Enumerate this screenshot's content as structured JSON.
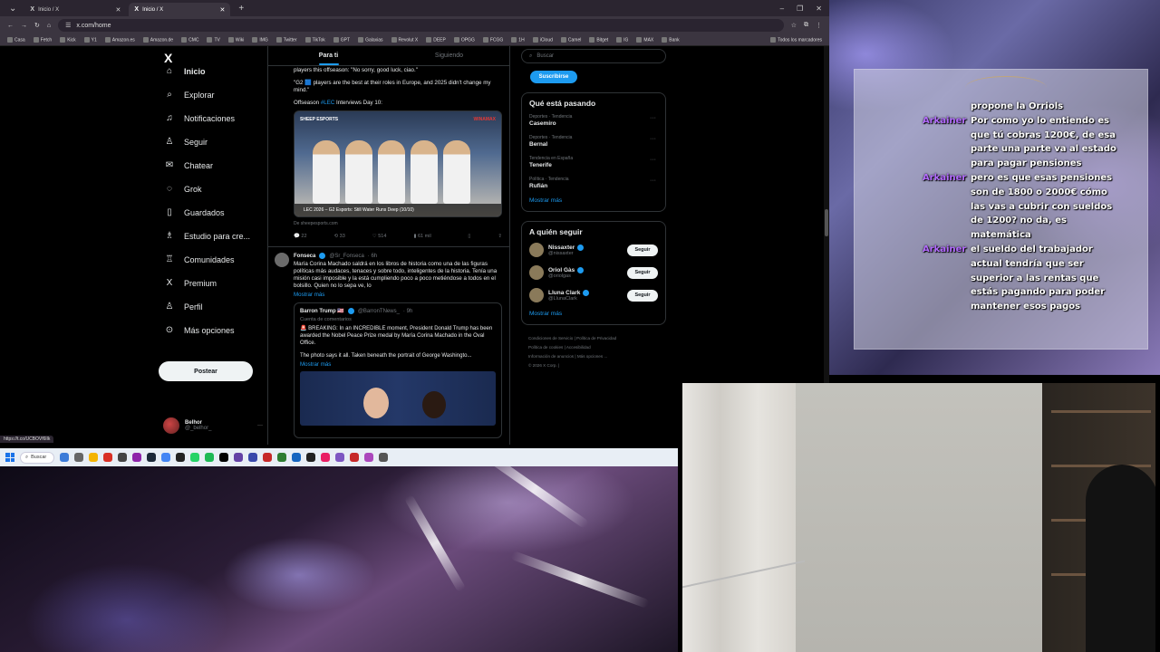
{
  "browser": {
    "tabs": [
      {
        "title": "Inicio / X",
        "active": false
      },
      {
        "title": "Inicio / X",
        "active": true
      }
    ],
    "url": "x.com/home",
    "bookmarks": [
      "Casa",
      "Fetch",
      "Kick",
      "Y1",
      "Amazon.es",
      "Amazon.de",
      "CMC",
      "TV",
      "Wiki",
      "IMG",
      "Twitter",
      "TikTok",
      "GPT",
      "Galaxias",
      "Revolut X",
      "DEEP",
      "OPGG",
      "FCGG",
      "1H",
      "iCloud",
      "Camel",
      "Bitget",
      "IG",
      "MAX",
      "Bank"
    ],
    "all_bookmarks": "Todos los marcadores",
    "status_url": "https://t.co/UCBOVf6lIk"
  },
  "nav": {
    "items": [
      {
        "label": "Inicio",
        "icon": "home-icon",
        "glyph": "⌂"
      },
      {
        "label": "Explorar",
        "icon": "search-icon",
        "glyph": "⌕"
      },
      {
        "label": "Notificaciones",
        "icon": "bell-icon",
        "glyph": "♫"
      },
      {
        "label": "Seguir",
        "icon": "follow-icon",
        "glyph": "♙"
      },
      {
        "label": "Chatear",
        "icon": "chat-icon",
        "glyph": "✉"
      },
      {
        "label": "Grok",
        "icon": "grok-icon",
        "glyph": "◌"
      },
      {
        "label": "Guardados",
        "icon": "bookmark-icon",
        "glyph": "▯"
      },
      {
        "label": "Estudio para cre...",
        "icon": "studio-icon",
        "glyph": "♗"
      },
      {
        "label": "Comunidades",
        "icon": "communities-icon",
        "glyph": "♖"
      },
      {
        "label": "Premium",
        "icon": "premium-x-icon",
        "glyph": "X"
      },
      {
        "label": "Perfil",
        "icon": "profile-icon",
        "glyph": "♙"
      },
      {
        "label": "Más opciones",
        "icon": "more-icon",
        "glyph": "⊙"
      }
    ],
    "post_label": "Postear",
    "profile_name": "Belhor",
    "profile_handle": "@_belhor_"
  },
  "feed": {
    "tabs": [
      "Para ti",
      "Siguiendo"
    ],
    "tweet1": {
      "text_top": "players this offseason: \"No sorry, good luck, ciao.\"",
      "text_mid": "\"G2 🟦 players are the best at their roles in Europe, and 2025 didn't change my mind.\"",
      "text_pre": "Offseason",
      "hashtag": "#LEC",
      "text_post": "Interviews Day 10:",
      "media_logo": "SHEEP ESPORTS",
      "media_brand": "WINAMAX",
      "media_caption": "LEC 2026 – G2 Esports: Still Water Runs Deep (10/10)",
      "card_source": "De sheepesports.com",
      "stats": {
        "replies": "22",
        "reposts": "33",
        "likes": "514",
        "views": "61 mil"
      }
    },
    "tweet2": {
      "name": "Fonseca",
      "handle": "@Sr_Fonseca",
      "time": "· 6h",
      "text": "María Corina Machado saldrá en los libros de historia como una de las figuras políticas más audaces, tenaces y sobre todo, inteligentes de la historia. Tenía una misión casi imposible y la está cumpliendo poco a poco metiéndose a todos en el bolsillo. Quien no lo sepa ve, lo",
      "show_more": "Mostrar más",
      "quote": {
        "name": "Barron Trump 🇺🇸",
        "handle": "@BarronTNews_",
        "time": "· 9h",
        "context": "Cuenta de comentarios",
        "text": "🚨 BREAKING: In an INCREDIBLE moment, President Donald Trump has been awarded the Nobel Peace Prize medal by María Corina Machado in the Oval Office.",
        "text2": "The photo says it all. Taken beneath the portrait of George Washingto...",
        "show_more": "Mostrar más"
      }
    }
  },
  "sidebar": {
    "search_placeholder": "Buscar",
    "subscribe_label": "Suscribirse",
    "trending_title": "Qué está pasando",
    "trends": [
      {
        "context": "Deportes · Tendencia",
        "title": "Casemiro"
      },
      {
        "context": "Deportes · Tendencia",
        "title": "Bernal"
      },
      {
        "context": "Tendencia en España",
        "title": "Tenerife"
      },
      {
        "context": "Política · Tendencia",
        "title": "Rufián"
      }
    ],
    "show_more": "Mostrar más",
    "who_title": "A quién seguir",
    "who": [
      {
        "name": "Nissaxter",
        "handle": "@nissaxter",
        "button": "Seguir"
      },
      {
        "name": "Oriol Gàs",
        "handle": "@oriolgas",
        "button": "Seguir"
      },
      {
        "name": "Lluna Clark",
        "handle": "@LlunaClark",
        "button": "Seguir"
      }
    ],
    "who_more": "Mostrar más",
    "footer": [
      "Condiciones de Servicio",
      "Política de Privacidad",
      "Política de cookies",
      "Accesibilidad",
      "Información de anuncios",
      "Más opciones ...",
      "© 2026 X Corp."
    ]
  },
  "taskbar": {
    "search_label": "Buscar"
  },
  "chat": {
    "messages": [
      {
        "user": "",
        "text": "propone la Orriols"
      },
      {
        "user": "Arkainer",
        "text": "Por como yo lo entiendo es que tú cobras 1200€, de esa parte una parte va al estado para pagar pensiones"
      },
      {
        "user": "Arkainer",
        "text": "pero es que esas pensiones son de 1800 o 2000€ cómo las vas a cubrir con sueldos de 1200? no da, es matemática"
      },
      {
        "user": "Arkainer",
        "text": "el sueldo del trabajador actual tendría que ser superior a las rentas que estás pagando para poder mantener esos pagos"
      }
    ]
  },
  "colors": {
    "accent": "#1d9bf0",
    "chat_user": "#b36bff",
    "bg": "#000000"
  }
}
